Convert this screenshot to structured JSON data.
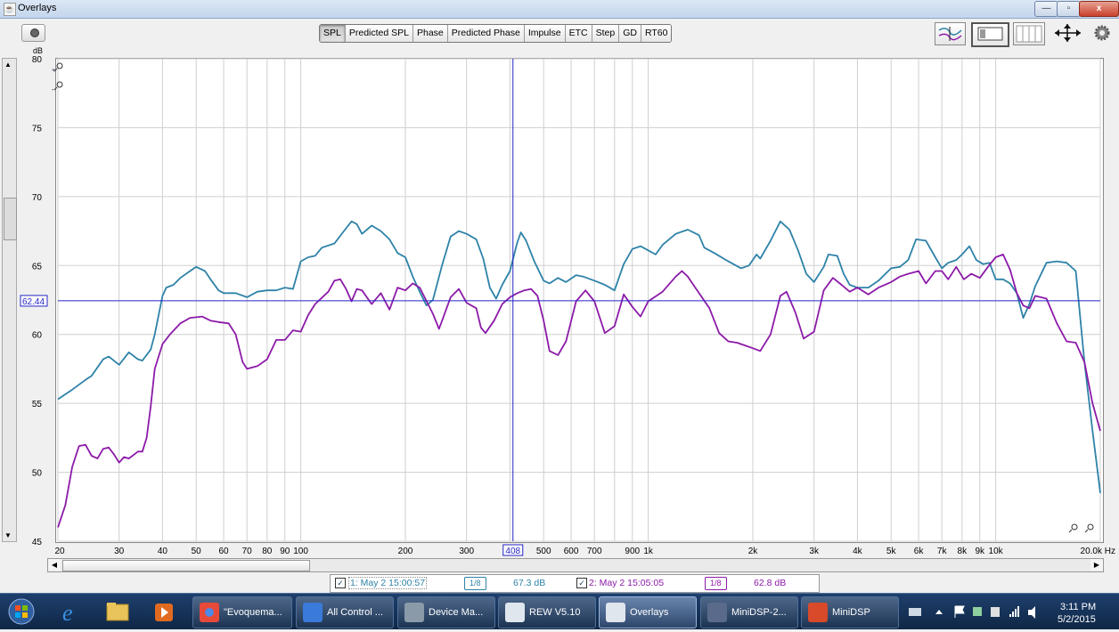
{
  "window": {
    "title": "Overlays",
    "min": "—",
    "max": "▫",
    "close": "x"
  },
  "tabs": [
    {
      "label": "SPL",
      "active": true
    },
    {
      "label": "Predicted SPL",
      "active": false
    },
    {
      "label": "Phase",
      "active": false
    },
    {
      "label": "Predicted Phase",
      "active": false
    },
    {
      "label": "Impulse",
      "active": false
    },
    {
      "label": "ETC",
      "active": false
    },
    {
      "label": "Step",
      "active": false
    },
    {
      "label": "GD",
      "active": false
    },
    {
      "label": "RT60",
      "active": false
    }
  ],
  "cursor": {
    "x_readout": "408",
    "y_readout": "62.44",
    "x_value": 408,
    "y_value": 62.44
  },
  "legend": {
    "m1_label": "1: May 2 15:00:57",
    "m1_smoothing": "1/8",
    "m1_value": "67.3 dB",
    "m2_label": "2: May 2 15:05:05",
    "m2_smoothing": "1/8",
    "m2_value": "62.8 dB"
  },
  "colors": {
    "m1": "#2e82a8",
    "m2": "#8c1aa8",
    "cursor": "#2424c8",
    "grid": "#cfcfcf"
  },
  "chart_data": {
    "type": "line",
    "xscale": "log",
    "xlim": [
      20,
      20000
    ],
    "ylim": [
      45,
      80
    ],
    "ylabel": "dB",
    "yticks": [
      {
        "v": 80,
        "label": "80"
      },
      {
        "v": 75,
        "label": "75"
      },
      {
        "v": 70,
        "label": "70"
      },
      {
        "v": 65,
        "label": "65"
      },
      {
        "v": 60,
        "label": "60"
      },
      {
        "v": 55,
        "label": "55"
      },
      {
        "v": 50,
        "label": "50"
      },
      {
        "v": 45,
        "label": "45"
      }
    ],
    "xticks": [
      {
        "v": 20,
        "label": "20"
      },
      {
        "v": 30,
        "label": "30"
      },
      {
        "v": 40,
        "label": "40"
      },
      {
        "v": 50,
        "label": "50"
      },
      {
        "v": 60,
        "label": "60"
      },
      {
        "v": 70,
        "label": "70"
      },
      {
        "v": 80,
        "label": "80"
      },
      {
        "v": 90,
        "label": "90"
      },
      {
        "v": 100,
        "label": "100"
      },
      {
        "v": 200,
        "label": "200"
      },
      {
        "v": 300,
        "label": "300"
      },
      {
        "v": 500,
        "label": "500"
      },
      {
        "v": 600,
        "label": "600"
      },
      {
        "v": 700,
        "label": "700"
      },
      {
        "v": 900,
        "label": "900"
      },
      {
        "v": 1000,
        "label": "1k"
      },
      {
        "v": 2000,
        "label": "2k"
      },
      {
        "v": 3000,
        "label": "3k"
      },
      {
        "v": 4000,
        "label": "4k"
      },
      {
        "v": 5000,
        "label": "5k"
      },
      {
        "v": 6000,
        "label": "6k"
      },
      {
        "v": 7000,
        "label": "7k"
      },
      {
        "v": 8000,
        "label": "8k"
      },
      {
        "v": 9000,
        "label": "9k"
      },
      {
        "v": 10000,
        "label": "10k"
      },
      {
        "v": 20000,
        "label": "20.0k Hz"
      }
    ],
    "grid_minor": [
      400,
      800
    ],
    "series": [
      {
        "name": "1: May 2 15:00:57",
        "color": "#2e82a8",
        "points": [
          [
            20,
            55.3
          ],
          [
            22,
            56.0
          ],
          [
            24,
            56.7
          ],
          [
            25,
            57.0
          ],
          [
            27,
            58.2
          ],
          [
            28,
            58.4
          ],
          [
            30,
            57.8
          ],
          [
            32,
            58.7
          ],
          [
            34,
            58.2
          ],
          [
            35,
            58.1
          ],
          [
            37,
            58.9
          ],
          [
            38,
            60.0
          ],
          [
            40,
            62.8
          ],
          [
            41,
            63.4
          ],
          [
            43,
            63.6
          ],
          [
            45,
            64.1
          ],
          [
            48,
            64.6
          ],
          [
            50,
            64.9
          ],
          [
            53,
            64.6
          ],
          [
            55,
            64.0
          ],
          [
            58,
            63.2
          ],
          [
            60,
            63.0
          ],
          [
            65,
            63.0
          ],
          [
            70,
            62.7
          ],
          [
            75,
            63.1
          ],
          [
            80,
            63.2
          ],
          [
            85,
            63.2
          ],
          [
            90,
            63.4
          ],
          [
            95,
            63.3
          ],
          [
            100,
            65.3
          ],
          [
            105,
            65.6
          ],
          [
            110,
            65.7
          ],
          [
            115,
            66.3
          ],
          [
            125,
            66.6
          ],
          [
            135,
            67.7
          ],
          [
            140,
            68.2
          ],
          [
            145,
            68.0
          ],
          [
            150,
            67.3
          ],
          [
            160,
            67.9
          ],
          [
            170,
            67.5
          ],
          [
            180,
            66.9
          ],
          [
            190,
            65.9
          ],
          [
            200,
            65.6
          ],
          [
            210,
            64.2
          ],
          [
            220,
            63.1
          ],
          [
            230,
            62.1
          ],
          [
            240,
            62.5
          ],
          [
            255,
            65.0
          ],
          [
            270,
            67.1
          ],
          [
            285,
            67.5
          ],
          [
            300,
            67.3
          ],
          [
            320,
            66.9
          ],
          [
            335,
            65.5
          ],
          [
            350,
            63.4
          ],
          [
            365,
            62.6
          ],
          [
            380,
            63.6
          ],
          [
            400,
            64.6
          ],
          [
            420,
            66.7
          ],
          [
            430,
            67.4
          ],
          [
            445,
            66.8
          ],
          [
            470,
            65.3
          ],
          [
            500,
            63.9
          ],
          [
            520,
            63.7
          ],
          [
            550,
            64.1
          ],
          [
            580,
            63.8
          ],
          [
            620,
            64.3
          ],
          [
            650,
            64.2
          ],
          [
            700,
            63.9
          ],
          [
            750,
            63.6
          ],
          [
            800,
            63.2
          ],
          [
            850,
            65.1
          ],
          [
            900,
            66.2
          ],
          [
            950,
            66.4
          ],
          [
            1000,
            66.1
          ],
          [
            1050,
            65.8
          ],
          [
            1100,
            66.5
          ],
          [
            1200,
            67.3
          ],
          [
            1300,
            67.6
          ],
          [
            1400,
            67.2
          ],
          [
            1450,
            66.3
          ],
          [
            1550,
            65.9
          ],
          [
            1700,
            65.3
          ],
          [
            1850,
            64.8
          ],
          [
            1950,
            65.0
          ],
          [
            2050,
            65.8
          ],
          [
            2100,
            65.5
          ],
          [
            2250,
            66.8
          ],
          [
            2400,
            68.2
          ],
          [
            2550,
            67.6
          ],
          [
            2700,
            66.1
          ],
          [
            2850,
            64.4
          ],
          [
            3000,
            63.8
          ],
          [
            3200,
            64.9
          ],
          [
            3300,
            65.8
          ],
          [
            3500,
            65.7
          ],
          [
            3650,
            64.4
          ],
          [
            3800,
            63.6
          ],
          [
            4000,
            63.4
          ],
          [
            4300,
            63.4
          ],
          [
            4600,
            63.9
          ],
          [
            5000,
            64.8
          ],
          [
            5300,
            64.9
          ],
          [
            5600,
            65.4
          ],
          [
            5900,
            66.9
          ],
          [
            6300,
            66.8
          ],
          [
            6700,
            65.6
          ],
          [
            7000,
            64.8
          ],
          [
            7300,
            65.2
          ],
          [
            7700,
            65.4
          ],
          [
            8000,
            65.8
          ],
          [
            8400,
            66.4
          ],
          [
            8800,
            65.4
          ],
          [
            9200,
            65.1
          ],
          [
            9600,
            65.2
          ],
          [
            10000,
            64.0
          ],
          [
            10500,
            64.0
          ],
          [
            11000,
            63.7
          ],
          [
            11500,
            63.0
          ],
          [
            12000,
            61.2
          ],
          [
            12500,
            62.2
          ],
          [
            13000,
            63.5
          ],
          [
            14000,
            65.2
          ],
          [
            15000,
            65.3
          ],
          [
            16000,
            65.2
          ],
          [
            17000,
            64.6
          ],
          [
            18000,
            58.0
          ],
          [
            19000,
            53.0
          ],
          [
            20000,
            48.5
          ]
        ]
      },
      {
        "name": "2: May 2 15:05:05",
        "color": "#8c1aa8",
        "points": [
          [
            20,
            46.0
          ],
          [
            21,
            47.6
          ],
          [
            22,
            50.4
          ],
          [
            23,
            51.9
          ],
          [
            24,
            52.0
          ],
          [
            25,
            51.2
          ],
          [
            26,
            51.0
          ],
          [
            27,
            51.7
          ],
          [
            28,
            51.8
          ],
          [
            29,
            51.3
          ],
          [
            30,
            50.7
          ],
          [
            31,
            51.1
          ],
          [
            32,
            51.0
          ],
          [
            34,
            51.5
          ],
          [
            35,
            51.5
          ],
          [
            36,
            52.5
          ],
          [
            37,
            54.8
          ],
          [
            38,
            57.5
          ],
          [
            40,
            59.3
          ],
          [
            42,
            60.0
          ],
          [
            45,
            60.8
          ],
          [
            48,
            61.2
          ],
          [
            52,
            61.3
          ],
          [
            55,
            61.0
          ],
          [
            58,
            60.9
          ],
          [
            62,
            60.8
          ],
          [
            65,
            60.0
          ],
          [
            68,
            58.0
          ],
          [
            70,
            57.5
          ],
          [
            75,
            57.7
          ],
          [
            80,
            58.2
          ],
          [
            85,
            59.6
          ],
          [
            90,
            59.6
          ],
          [
            95,
            60.3
          ],
          [
            100,
            60.2
          ],
          [
            105,
            61.4
          ],
          [
            110,
            62.2
          ],
          [
            120,
            63.1
          ],
          [
            125,
            63.9
          ],
          [
            130,
            64.0
          ],
          [
            135,
            63.3
          ],
          [
            140,
            62.4
          ],
          [
            145,
            63.3
          ],
          [
            150,
            63.2
          ],
          [
            160,
            62.2
          ],
          [
            170,
            63.0
          ],
          [
            180,
            61.8
          ],
          [
            190,
            63.4
          ],
          [
            200,
            63.2
          ],
          [
            210,
            63.7
          ],
          [
            220,
            63.4
          ],
          [
            240,
            61.5
          ],
          [
            250,
            60.4
          ],
          [
            270,
            62.7
          ],
          [
            285,
            63.3
          ],
          [
            300,
            62.3
          ],
          [
            320,
            61.9
          ],
          [
            330,
            60.5
          ],
          [
            340,
            60.1
          ],
          [
            360,
            61.0
          ],
          [
            380,
            62.2
          ],
          [
            400,
            62.7
          ],
          [
            420,
            63.0
          ],
          [
            440,
            63.2
          ],
          [
            460,
            63.3
          ],
          [
            480,
            62.8
          ],
          [
            500,
            61.0
          ],
          [
            520,
            58.8
          ],
          [
            550,
            58.5
          ],
          [
            580,
            59.5
          ],
          [
            620,
            62.4
          ],
          [
            660,
            63.2
          ],
          [
            700,
            62.4
          ],
          [
            750,
            60.1
          ],
          [
            800,
            60.6
          ],
          [
            850,
            62.9
          ],
          [
            900,
            62.0
          ],
          [
            950,
            61.3
          ],
          [
            1000,
            62.4
          ],
          [
            1100,
            63.1
          ],
          [
            1200,
            64.2
          ],
          [
            1250,
            64.6
          ],
          [
            1300,
            64.2
          ],
          [
            1400,
            63.0
          ],
          [
            1500,
            61.9
          ],
          [
            1600,
            60.1
          ],
          [
            1700,
            59.5
          ],
          [
            1800,
            59.4
          ],
          [
            1900,
            59.2
          ],
          [
            2000,
            59.0
          ],
          [
            2100,
            58.8
          ],
          [
            2250,
            60.0
          ],
          [
            2400,
            62.8
          ],
          [
            2500,
            63.1
          ],
          [
            2650,
            61.6
          ],
          [
            2800,
            59.7
          ],
          [
            3000,
            60.2
          ],
          [
            3200,
            63.2
          ],
          [
            3400,
            64.1
          ],
          [
            3600,
            63.6
          ],
          [
            3800,
            63.1
          ],
          [
            4000,
            63.4
          ],
          [
            4300,
            62.9
          ],
          [
            4600,
            63.4
          ],
          [
            5000,
            63.8
          ],
          [
            5300,
            64.2
          ],
          [
            5600,
            64.4
          ],
          [
            6000,
            64.6
          ],
          [
            6300,
            63.7
          ],
          [
            6700,
            64.6
          ],
          [
            7000,
            64.6
          ],
          [
            7300,
            64.0
          ],
          [
            7700,
            64.9
          ],
          [
            8100,
            64.0
          ],
          [
            8500,
            64.4
          ],
          [
            9000,
            64.1
          ],
          [
            9500,
            64.9
          ],
          [
            10000,
            65.6
          ],
          [
            10500,
            65.8
          ],
          [
            11000,
            64.7
          ],
          [
            11500,
            63.0
          ],
          [
            12000,
            62.1
          ],
          [
            12500,
            61.9
          ],
          [
            13000,
            62.8
          ],
          [
            14000,
            62.6
          ],
          [
            15000,
            60.8
          ],
          [
            16000,
            59.5
          ],
          [
            17000,
            59.4
          ],
          [
            18000,
            58.0
          ],
          [
            19000,
            55.0
          ],
          [
            20000,
            53.0
          ]
        ]
      }
    ]
  },
  "taskbar": {
    "items": [
      {
        "label": "\"Evoquema...",
        "color": "#e84a3a"
      },
      {
        "label": "All Control ...",
        "color": "#3a7ad8"
      },
      {
        "label": "Device Ma...",
        "color": "#8a9aa8"
      },
      {
        "label": "REW V5.10",
        "color": "#e0e6ee"
      },
      {
        "label": "Overlays",
        "color": "#e0e6ee"
      },
      {
        "label": "MiniDSP-2...",
        "color": "#5a6a8a"
      },
      {
        "label": "MiniDSP",
        "color": "#d84a2a"
      }
    ],
    "time": "3:11 PM",
    "date": "5/2/2015"
  }
}
